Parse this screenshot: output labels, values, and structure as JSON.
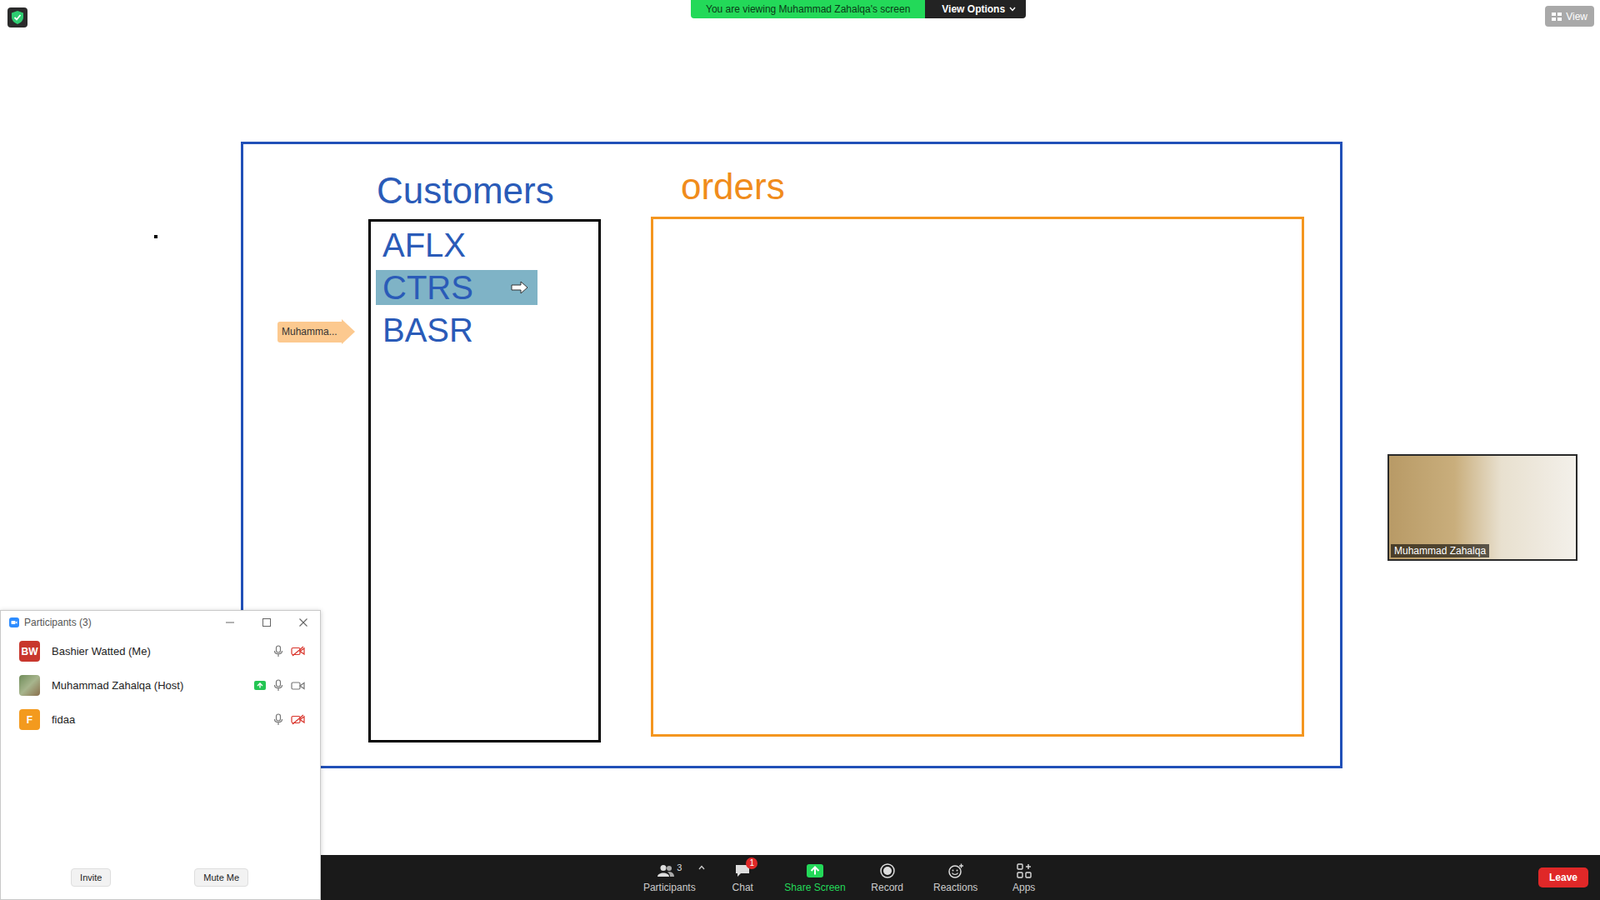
{
  "banner": {
    "text": "You are viewing Muhammad Zahalqa's screen",
    "options_label": "View Options"
  },
  "view_button": {
    "label": "View"
  },
  "shared_screen": {
    "customers": {
      "title": "Customers",
      "items": [
        {
          "label": "AFLX",
          "selected": false
        },
        {
          "label": "CTRS",
          "selected": true
        },
        {
          "label": "BASR",
          "selected": false
        }
      ]
    },
    "orders": {
      "title": "orders",
      "items": []
    },
    "pointer_label": "Muhamma..."
  },
  "video_tile": {
    "name": "Muhammad Zahalqa"
  },
  "participants_panel": {
    "title": "Participants (3)",
    "participants": [
      {
        "name": "Bashier Watted (Me)",
        "initials": "BW",
        "kind": "initials",
        "color": "#c8372d",
        "sharing": false,
        "muted": false,
        "video_on": false
      },
      {
        "name": "Muhammad Zahalqa (Host)",
        "kind": "photo",
        "sharing": true,
        "muted": false,
        "video_on": true
      },
      {
        "name": "fidaa",
        "initials": "F",
        "kind": "initials",
        "color": "#f39a1e",
        "sharing": false,
        "muted": false,
        "video_on": false
      }
    ],
    "buttons": [
      {
        "label": "Invite"
      },
      {
        "label": "Mute Me"
      }
    ]
  },
  "toolbar": {
    "items": [
      {
        "label": "Participants",
        "count": "3",
        "has_menu": true,
        "highlighted": false
      },
      {
        "label": "Chat",
        "badge": "1",
        "has_menu": false,
        "highlighted": false
      },
      {
        "label": "Share Screen",
        "has_menu": false,
        "highlighted": true
      },
      {
        "label": "Record",
        "has_menu": false,
        "highlighted": false
      },
      {
        "label": "Reactions",
        "has_menu": false,
        "highlighted": false
      },
      {
        "label": "Apps",
        "has_menu": false,
        "highlighted": false
      }
    ],
    "leave": "Leave"
  }
}
